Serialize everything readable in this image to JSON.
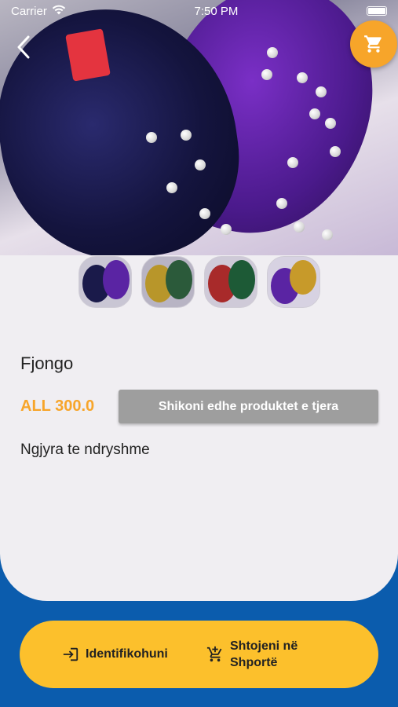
{
  "status_bar": {
    "carrier": "Carrier",
    "time": "7:50 PM"
  },
  "product": {
    "title": "Fjongo",
    "price": "ALL 300.0",
    "description": "Ngjyra te ndryshme"
  },
  "buttons": {
    "see_more": "Shikoni edhe produktet e tjera",
    "login": "Identifikohuni",
    "add_to_cart_line1": "Shtojeni në",
    "add_to_cart_line2": "Shportë"
  },
  "colors": {
    "accent_orange": "#f7a52a",
    "action_bar_yellow": "#fcc02c",
    "background_blue": "#0b5cad",
    "button_gray": "#9e9e9e"
  },
  "icons": [
    "back-arrow-icon",
    "cart-icon",
    "login-icon",
    "add-to-cart-icon",
    "wifi-icon",
    "battery-icon"
  ]
}
